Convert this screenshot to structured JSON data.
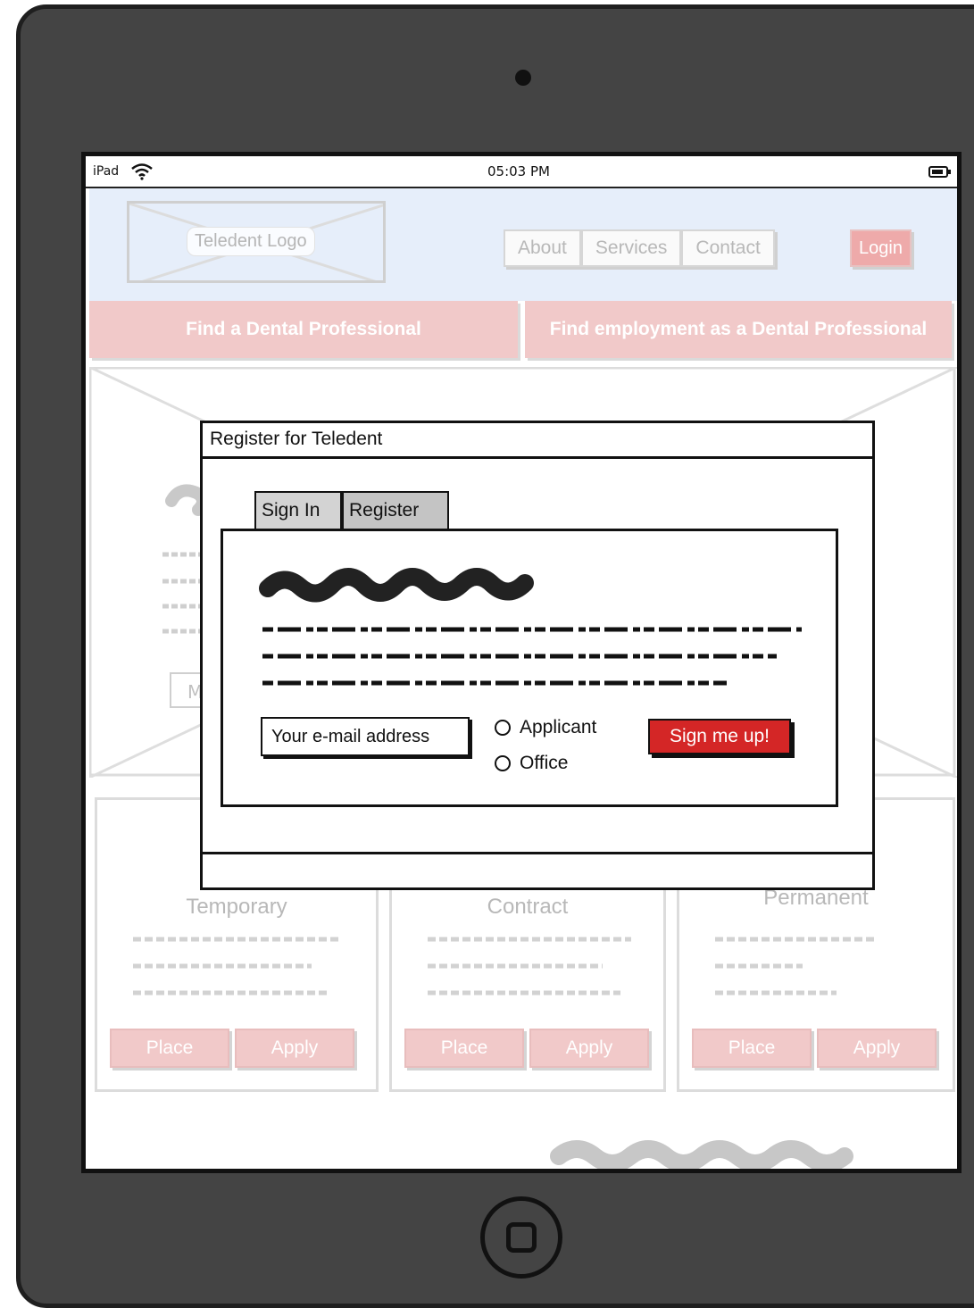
{
  "status_bar": {
    "device": "iPad",
    "time": "05:03 PM"
  },
  "header": {
    "logo_text": "Teledent Logo",
    "nav": [
      "About",
      "Services",
      "Contact"
    ],
    "login": "Login"
  },
  "cta": {
    "find_pro": "Find a Dental Professional",
    "find_job": "Find employment as a Dental Professional"
  },
  "hero": {
    "button_partial": "M"
  },
  "cards": [
    {
      "title": "Temporary",
      "place": "Place",
      "apply": "Apply"
    },
    {
      "title": "Contract",
      "place": "Place",
      "apply": "Apply"
    },
    {
      "title": "Permanent",
      "place": "Place",
      "apply": "Apply"
    }
  ],
  "modal": {
    "title": "Register for Teledent",
    "tabs": [
      "Sign In",
      "Register"
    ],
    "email_placeholder": "Your e-mail address",
    "radio_options": [
      "Applicant",
      "Office"
    ],
    "submit": "Sign me up!"
  }
}
